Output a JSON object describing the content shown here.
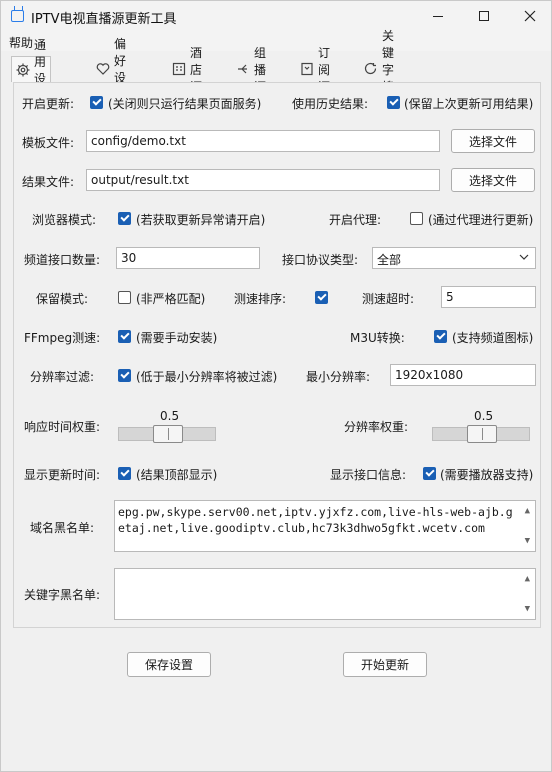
{
  "window": {
    "title": "IPTV电视直播源更新工具"
  },
  "menu": {
    "help": "帮助"
  },
  "tabs": [
    {
      "label": "通用设置",
      "icon": "gear-icon"
    },
    {
      "label": "偏好设置",
      "icon": "heart-icon"
    },
    {
      "label": "酒店源",
      "icon": "hotel-icon"
    },
    {
      "label": "组播源",
      "icon": "multicast-icon"
    },
    {
      "label": "订阅源",
      "icon": "subscribe-icon"
    },
    {
      "label": "关键字搜索",
      "icon": "search-icon"
    }
  ],
  "form": {
    "open_update": {
      "label": "开启更新:",
      "checked": true,
      "desc": "(关闭则只运行结果页面服务)"
    },
    "use_history": {
      "label": "使用历史结果:",
      "checked": true,
      "desc": "(保留上次更新可用结果)"
    },
    "template_file": {
      "label": "模板文件:",
      "value": "config/demo.txt",
      "button": "选择文件"
    },
    "result_file": {
      "label": "结果文件:",
      "value": "output/result.txt",
      "button": "选择文件"
    },
    "browser_mode": {
      "label": "浏览器模式:",
      "checked": true,
      "desc": "(若获取更新异常请开启)"
    },
    "proxy": {
      "label": "开启代理:",
      "checked": false,
      "desc": "(通过代理进行更新)"
    },
    "channel_count": {
      "label": "频道接口数量:",
      "value": "30"
    },
    "protocol": {
      "label": "接口协议类型:",
      "value": "全部"
    },
    "keep_mode": {
      "label": "保留模式:",
      "checked": false,
      "desc": "(非严格匹配)"
    },
    "speed_sort": {
      "label": "测速排序:",
      "checked": true
    },
    "speed_timeout": {
      "label": "测速超时:",
      "value": "5"
    },
    "ffmpeg": {
      "label": "FFmpeg测速:",
      "checked": true,
      "desc": "(需要手动安装)"
    },
    "m3u": {
      "label": "M3U转换:",
      "checked": true,
      "desc": "(支持频道图标)"
    },
    "res_filter": {
      "label": "分辨率过滤:",
      "checked": true,
      "desc": "(低于最小分辨率将被过滤)"
    },
    "min_res": {
      "label": "最小分辨率:",
      "value": "1920x1080"
    },
    "resp_weight": {
      "label": "响应时间权重:",
      "value": "0.5",
      "level": 0.5
    },
    "res_weight": {
      "label": "分辨率权重:",
      "value": "0.5",
      "level": 0.5
    },
    "show_time": {
      "label": "显示更新时间:",
      "checked": true,
      "desc": "(结果顶部显示)"
    },
    "show_info": {
      "label": "显示接口信息:",
      "checked": true,
      "desc": "(需要播放器支持)"
    },
    "domain_blacklist": {
      "label": "域名黑名单:",
      "value": "epg.pw,skype.serv00.net,iptv.yjxfz.com,live-hls-web-ajb.getaj.net,live.goodiptv.club,hc73k3dhwo5gfkt.wcetv.com"
    },
    "keyword_blacklist": {
      "label": "关键字黑名单:",
      "value": ""
    }
  },
  "actions": {
    "save": "保存设置",
    "start": "开始更新"
  },
  "colors": {
    "accent": "#1a5fb4"
  }
}
